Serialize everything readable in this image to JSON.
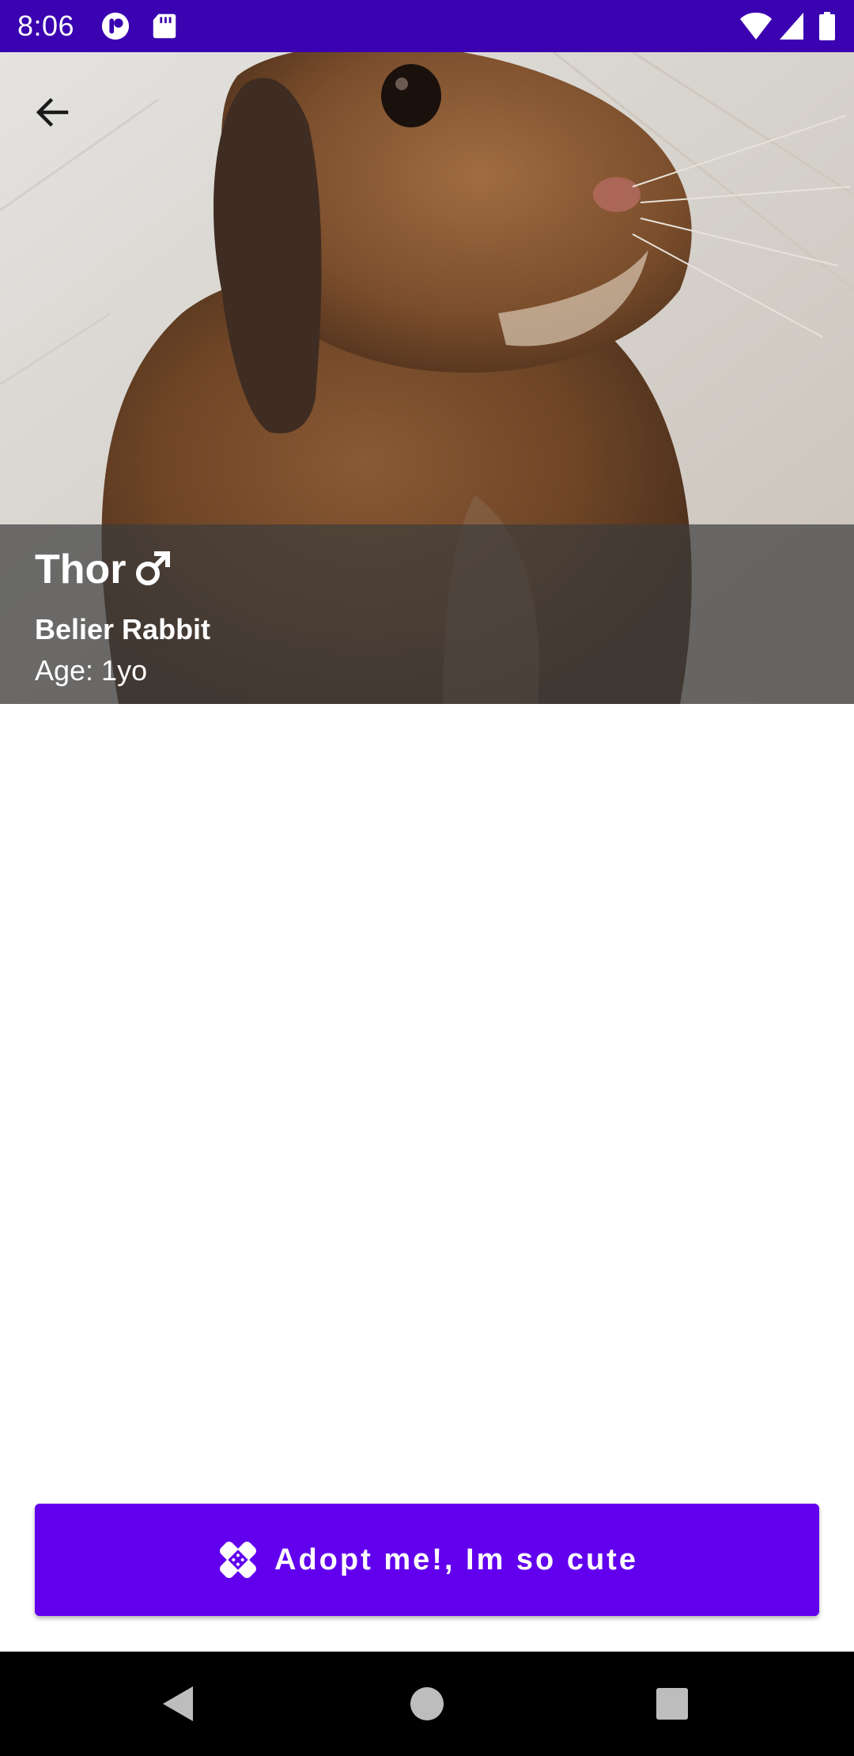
{
  "status_bar": {
    "time": "8:06",
    "background_color": "#3a02b0",
    "icons_left": [
      "notification-app-icon",
      "sd-card-icon"
    ],
    "icons_right": [
      "wifi-icon",
      "cellular-signal-icon",
      "battery-icon"
    ]
  },
  "hero": {
    "image_subject": "photo of a brown lop-eared rabbit",
    "back_icon": "arrow-back-icon"
  },
  "pet": {
    "name": "Thor",
    "gender_icon": "male-symbol-icon",
    "breed": "Belier Rabbit",
    "age": "Age: 1yo"
  },
  "adopt_button": {
    "label": "Adopt me!, Im so cute",
    "icon": "bandage-icon",
    "color": "#6200ee"
  },
  "nav_bar": {
    "buttons": [
      "back-triangle-icon",
      "home-circle-icon",
      "recents-square-icon"
    ]
  }
}
